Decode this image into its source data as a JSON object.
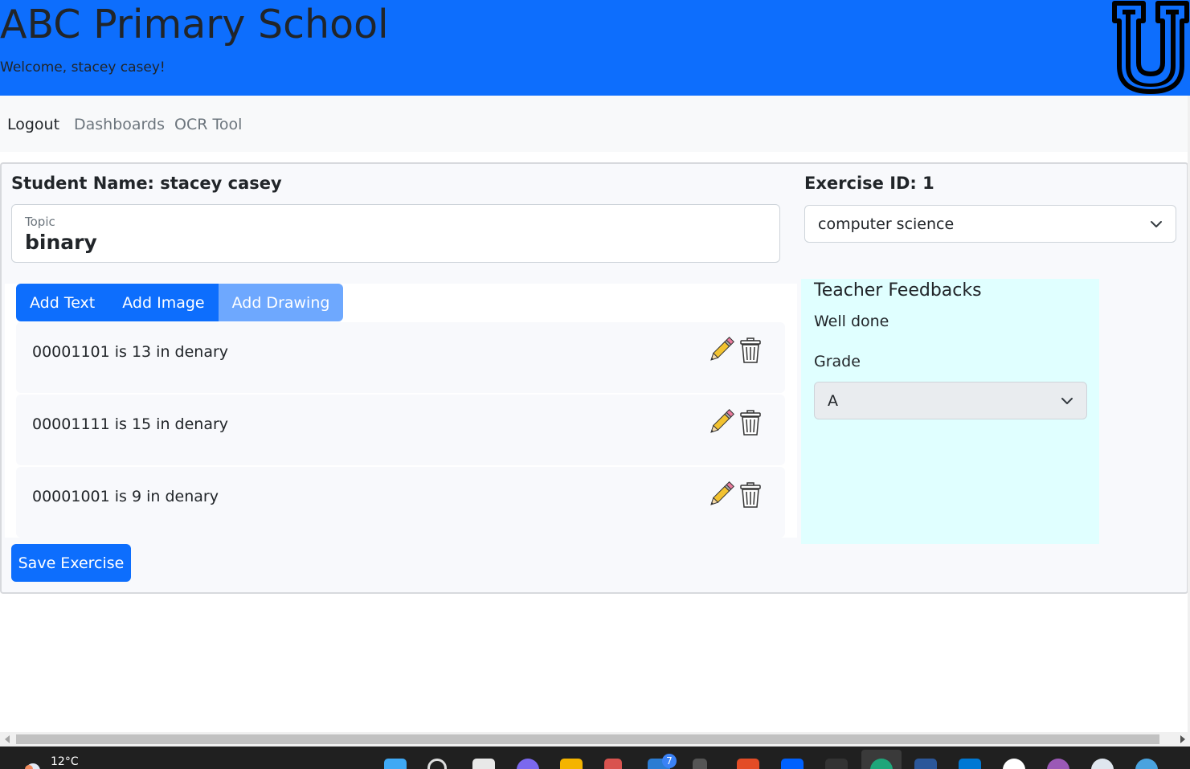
{
  "header": {
    "title": "ABC Primary School",
    "welcome": "Welcome, stacey casey!",
    "logo_icon": "university-u-logo"
  },
  "nav": {
    "items": [
      {
        "label": "Logout",
        "active": true
      },
      {
        "label": "Dashboards",
        "active": false
      },
      {
        "label": "OCR Tool",
        "active": false
      }
    ]
  },
  "exercise": {
    "student_label": "Student Name: stacey casey",
    "exercise_id_label": "Exercise ID: 1",
    "topic_label": "Topic",
    "topic_value": "binary",
    "subject_selected": "computer science",
    "add_buttons": [
      "Add Text",
      "Add Image",
      "Add Drawing"
    ],
    "entries": [
      {
        "text": "00001101 is 13 in denary"
      },
      {
        "text": "00001111 is 15 in denary"
      },
      {
        "text": "00001001 is 9 in denary"
      }
    ],
    "save_label": "Save Exercise"
  },
  "feedback": {
    "title": "Teacher Feedbacks",
    "text": "Well done",
    "grade_label": "Grade",
    "grade_selected": "A"
  },
  "taskbar": {
    "temperature": "12°C",
    "badge_count": "7"
  },
  "colors": {
    "primary": "#0d6efd",
    "primary_soft": "#6ea8fe",
    "feedback_bg": "#e0ffff",
    "taskbar": "#202020"
  }
}
